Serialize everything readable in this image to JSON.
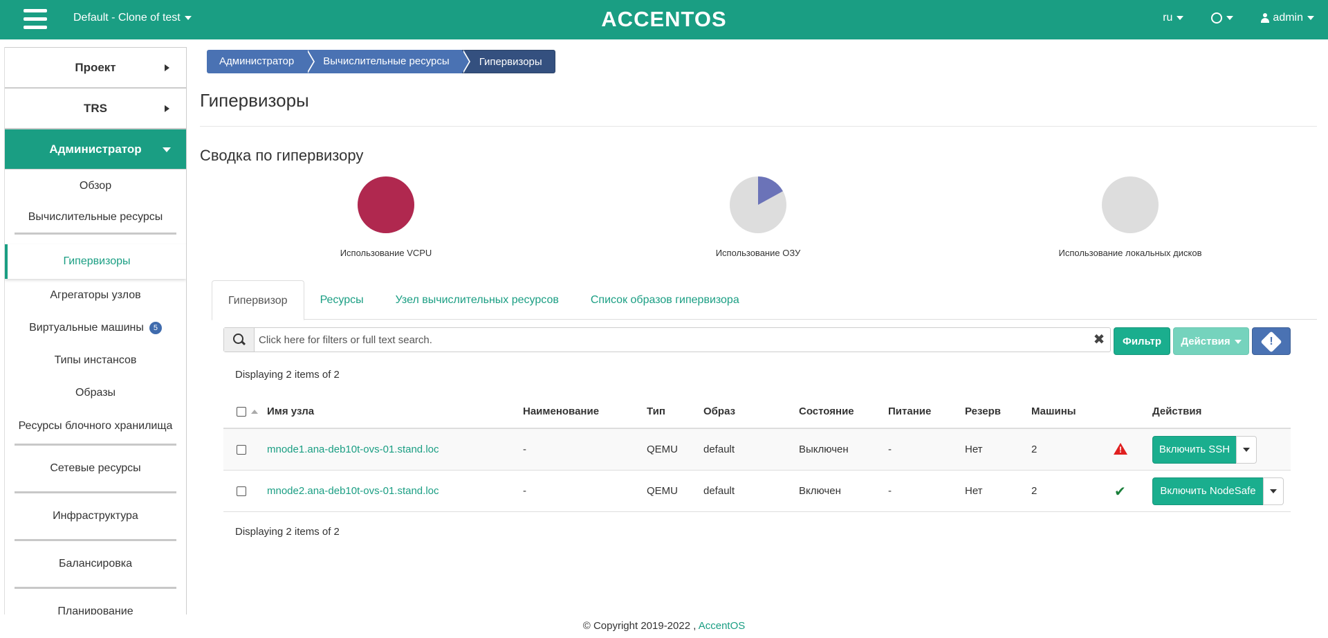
{
  "header": {
    "project": "Default - Clone of test",
    "logo": "ACCENTOS",
    "lang": "ru",
    "user": "admin"
  },
  "sidebar": {
    "sections": [
      {
        "label": "Проект"
      },
      {
        "label": "TRS"
      },
      {
        "label": "Администратор"
      }
    ],
    "items": [
      {
        "label": "Обзор"
      },
      {
        "label": "Вычислительные ресурсы"
      },
      {
        "label": "Гипервизоры"
      },
      {
        "label": "Агрегаторы узлов"
      },
      {
        "label": "Виртуальные машины",
        "badge": "5"
      },
      {
        "label": "Типы инстансов"
      },
      {
        "label": "Образы"
      },
      {
        "label": "Ресурсы блочного хранилища"
      },
      {
        "label": "Сетевые ресурсы"
      },
      {
        "label": "Инфраструктура"
      },
      {
        "label": "Балансировка"
      },
      {
        "label": "Планирование"
      }
    ]
  },
  "breadcrumb": [
    "Администратор",
    "Вычислительные ресурсы",
    "Гипервизоры"
  ],
  "page_title": "Гипервизоры",
  "summary": {
    "title": "Сводка по гипервизору",
    "charts": [
      {
        "label": "Использование VCPU",
        "fraction": 1.0,
        "color": "#b0284f"
      },
      {
        "label": "Использование ОЗУ",
        "fraction": 0.17,
        "color": "#6b73b8"
      },
      {
        "label": "Использование локальных дисков",
        "fraction": 0.0,
        "color": "#6b73b8"
      }
    ]
  },
  "tabs": [
    "Гипервизор",
    "Ресурсы",
    "Узел вычислительных ресурсов",
    "Список образов гипервизора"
  ],
  "search": {
    "placeholder": "Click here for filters or full text search."
  },
  "buttons": {
    "filter": "Фильтр",
    "actions": "Действия"
  },
  "count_text": "Displaying 2 items of 2",
  "table": {
    "columns": [
      "Имя узла",
      "Наименование",
      "Тип",
      "Образ",
      "Состояние",
      "Питание",
      "Резерв",
      "Машины",
      "Действия"
    ],
    "rows": [
      {
        "host": "mnode1.ana-deb10t-ovs-01.stand.loc",
        "name": "-",
        "type": "QEMU",
        "image": "default",
        "state": "Выключен",
        "power": "-",
        "reserve": "Нет",
        "machines": "2",
        "status": "warning",
        "action": "Включить SSH"
      },
      {
        "host": "mnode2.ana-deb10t-ovs-01.stand.loc",
        "name": "-",
        "type": "QEMU",
        "image": "default",
        "state": "Включен",
        "power": "-",
        "reserve": "Нет",
        "machines": "2",
        "status": "ok",
        "action": "Включить NodeSafe"
      }
    ]
  },
  "footer": {
    "text": "© Copyright 2019-2022 ,",
    "link": "AccentOS"
  }
}
